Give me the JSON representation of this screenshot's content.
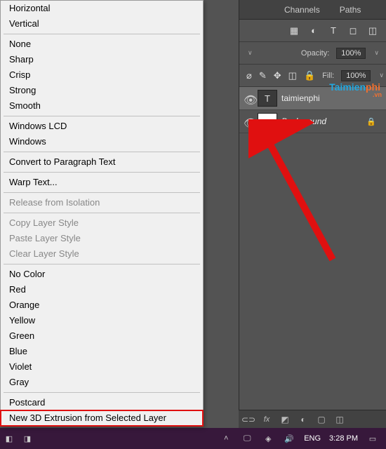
{
  "menu": {
    "group1": [
      "Horizontal",
      "Vertical"
    ],
    "group2": [
      "None",
      "Sharp",
      "Crisp",
      "Strong",
      "Smooth"
    ],
    "group3": [
      "Windows LCD",
      "Windows"
    ],
    "group4": [
      "Convert to Paragraph Text"
    ],
    "group5": [
      "Warp Text..."
    ],
    "group6": [
      "Release from Isolation"
    ],
    "group7": [
      "Copy Layer Style",
      "Paste Layer Style",
      "Clear Layer Style"
    ],
    "group8": [
      "No Color",
      "Red",
      "Orange",
      "Yellow",
      "Green",
      "Blue",
      "Violet",
      "Gray"
    ],
    "group9": [
      "Postcard",
      "New 3D Extrusion from Selected Layer"
    ]
  },
  "tabs": {
    "channels": "Channels",
    "paths": "Paths"
  },
  "layers": {
    "opacity_label": "Opacity:",
    "opacity_value": "100%",
    "fill_label": "Fill:",
    "fill_value": "100%",
    "layer1": {
      "name": "taimienphi",
      "thumb": "T"
    },
    "layer2": {
      "name": "Background"
    }
  },
  "taskbar": {
    "lang": "ENG",
    "time": "3:28 PM"
  },
  "watermark": {
    "part1": "Taimien",
    "part2": "phi",
    "suffix": ".vn"
  }
}
